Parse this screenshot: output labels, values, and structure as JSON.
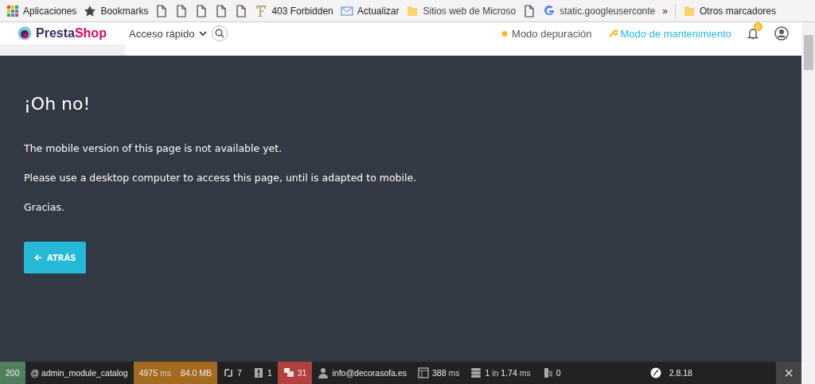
{
  "bookmarks_bar": {
    "items": [
      {
        "kind": "apps",
        "label": "Aplicaciones"
      },
      {
        "kind": "star",
        "label": "Bookmarks"
      },
      {
        "kind": "page"
      },
      {
        "kind": "page"
      },
      {
        "kind": "page"
      },
      {
        "kind": "page"
      },
      {
        "kind": "page"
      },
      {
        "kind": "font",
        "label": "403 Forbidden"
      },
      {
        "kind": "mail",
        "label": "Actualizar"
      },
      {
        "kind": "folder",
        "label": "Sitios web de Microso"
      },
      {
        "kind": "page"
      },
      {
        "kind": "google",
        "label": "static.googleuserconte"
      }
    ],
    "overflow": "»",
    "other": "Otros marcadores"
  },
  "header": {
    "logo": {
      "part_1": "Presta",
      "part_2": "Shop"
    },
    "quick_access": "Acceso rápido",
    "debug_mode": "Modo depuración",
    "maintenance_mode": "Modo de mantenimiento",
    "notification_count": "6"
  },
  "content": {
    "title": "¡Oh no!",
    "paragraphs": [
      "The mobile version of this page is not available yet.",
      "Please use a desktop computer to access this page, until is adapted to mobile.",
      "Gracias."
    ],
    "back_button": "ATRÁS"
  },
  "debug_toolbar": {
    "status": "200",
    "route": "@ admin_module_catalog",
    "time": "4975",
    "time_unit": "ms",
    "memory": "84.0 MB",
    "ajax": "7",
    "logs": "1",
    "translations": "31",
    "user": "info@decorasofa.es",
    "twig_time": "388",
    "twig_unit": "ms",
    "db_queries": "1",
    "db_in": "in",
    "db_time": "1.74",
    "db_unit": "ms",
    "cache": "0",
    "version": "2.8.18",
    "close": "×"
  }
}
